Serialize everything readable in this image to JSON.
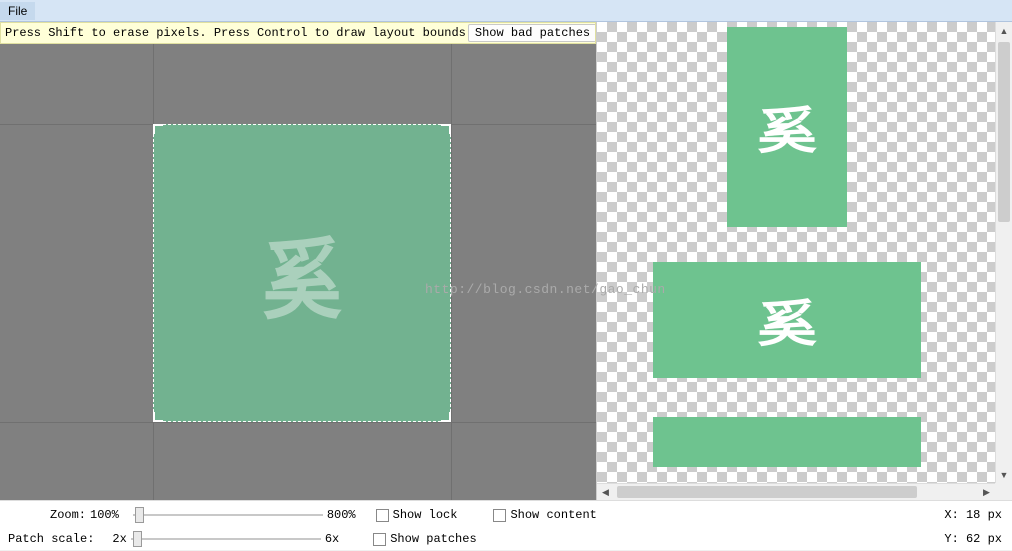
{
  "menubar": {
    "file": "File"
  },
  "hint": {
    "text": "Press Shift to erase pixels. Press Control to draw layout bounds",
    "bad_patches_btn": "Show bad patches"
  },
  "editor": {
    "glyph": "奚"
  },
  "preview": {
    "glyph1": "奚",
    "glyph2": "奚"
  },
  "controls": {
    "zoom_label": "Zoom:",
    "zoom_value": "100%",
    "zoom_max": "800%",
    "patch_scale_label": "Patch scale:",
    "patch_scale_min": "2x",
    "patch_scale_max": "6x",
    "show_lock": "Show lock",
    "show_content": "Show content",
    "show_patches": "Show patches"
  },
  "status": {
    "x_label": "X:",
    "x_value": "18 px",
    "y_label": "Y:",
    "y_value": "62 px"
  },
  "watermark": "http://blog.csdn.net/gao_chun"
}
